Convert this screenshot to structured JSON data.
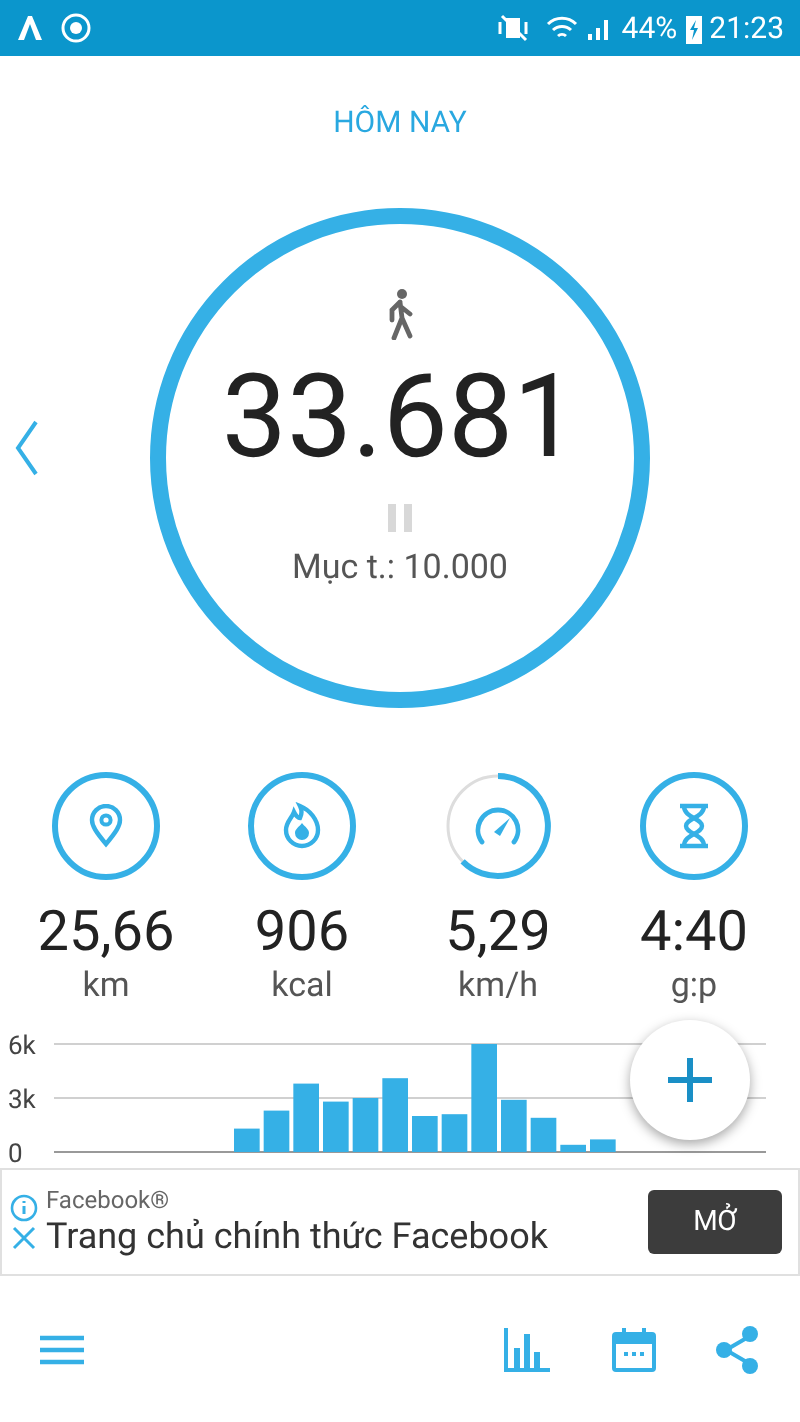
{
  "status_bar": {
    "battery": "44%",
    "time": "21:23"
  },
  "header": {
    "title": "HÔM NAY"
  },
  "steps": {
    "count": "33.681",
    "goal": "Mục t.: 10.000"
  },
  "stats": [
    {
      "kind": "distance",
      "value": "25,66",
      "unit": "km"
    },
    {
      "kind": "calories",
      "value": "906",
      "unit": "kcal"
    },
    {
      "kind": "speed",
      "value": "5,29",
      "unit": "km/h"
    },
    {
      "kind": "duration",
      "value": "4:40",
      "unit": "g:p"
    }
  ],
  "chart_data": {
    "type": "bar",
    "yticks": [
      {
        "value": 0,
        "label": "0"
      },
      {
        "value": 3000,
        "label": "3k"
      },
      {
        "value": 6000,
        "label": "6k"
      }
    ],
    "ylim": [
      0,
      6000
    ],
    "series": [
      {
        "color": "#35b0e6",
        "values": [
          0,
          0,
          0,
          0,
          0,
          0,
          1300,
          2300,
          3800,
          2800,
          3000,
          4100,
          2000,
          2100,
          6000,
          2900,
          1900,
          400,
          700,
          0,
          0,
          0,
          0,
          0
        ]
      }
    ]
  },
  "ad": {
    "advertiser": "Facebook®",
    "headline": "Trang chủ chính thức Facebook",
    "button": "MỞ"
  }
}
